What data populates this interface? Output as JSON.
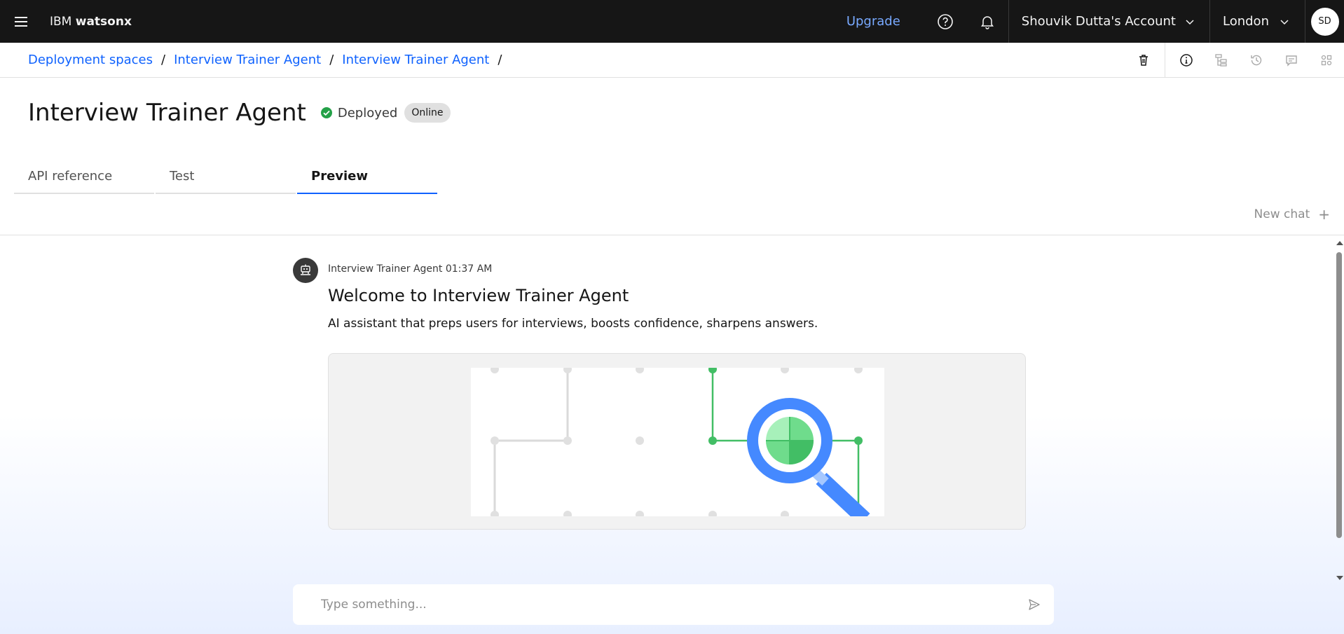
{
  "header": {
    "brand_prefix": "IBM",
    "brand_product": "watsonx",
    "upgrade_label": "Upgrade",
    "account_label": "Shouvik Dutta's Account",
    "region_label": "London",
    "avatar_initials": "SD"
  },
  "breadcrumb": {
    "items": [
      "Deployment spaces",
      "Interview Trainer Agent",
      "Interview Trainer Agent"
    ],
    "separator": "/"
  },
  "page": {
    "title": "Interview Trainer Agent",
    "status_label": "Deployed",
    "status_tag": "Online"
  },
  "tabs": [
    {
      "label": "API reference",
      "active": false
    },
    {
      "label": "Test",
      "active": false
    },
    {
      "label": "Preview",
      "active": true
    }
  ],
  "chat": {
    "new_chat_label": "New chat",
    "message": {
      "sender": "Interview Trainer Agent",
      "time": "01:37 AM",
      "meta": "Interview Trainer Agent 01:37 AM",
      "title": "Welcome to Interview Trainer Agent",
      "description": "AI assistant that preps users for interviews, boosts confidence, sharpens answers."
    },
    "input_placeholder": "Type something..."
  },
  "icons": {
    "menu": "hamburger-icon",
    "help": "help-icon",
    "notifications": "bell-icon",
    "delete": "trash-icon",
    "info": "info-icon",
    "structure": "tree-icon",
    "history": "history-icon",
    "comments": "chat-icon",
    "apps": "apps-icon",
    "send": "send-icon"
  },
  "colors": {
    "header_bg": "#161616",
    "link": "#0f62fe",
    "upgrade": "#78a9ff",
    "success": "#24a148",
    "tab_active": "#0f62fe"
  }
}
